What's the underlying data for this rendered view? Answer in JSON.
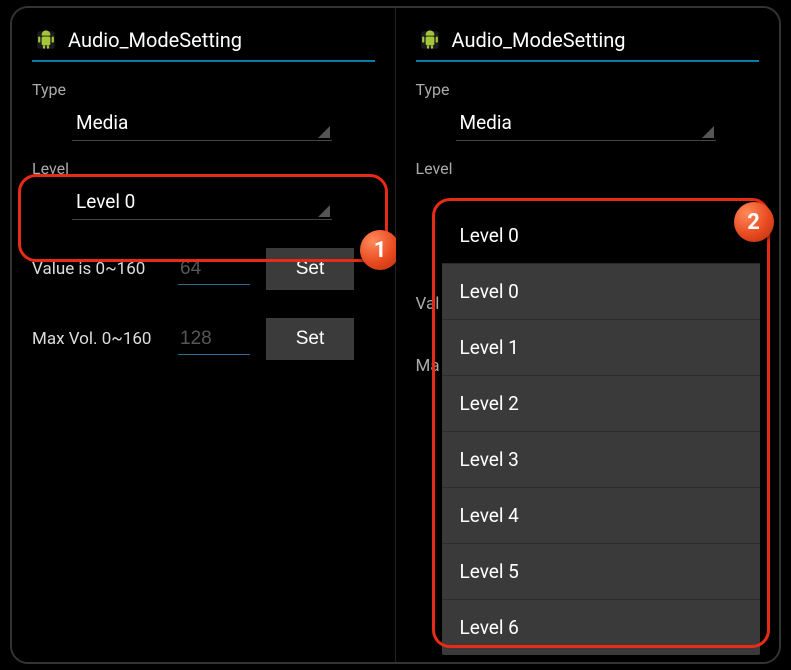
{
  "app": {
    "title": "Audio_ModeSetting"
  },
  "sections": {
    "type_label": "Type",
    "level_label": "Level"
  },
  "type_spinner": {
    "value": "Media"
  },
  "level_spinner": {
    "value": "Level 0"
  },
  "value_row": {
    "label": "Value is 0~160",
    "value": "64",
    "button": "Set"
  },
  "maxvol_row": {
    "label": "Max Vol. 0~160",
    "value": "128",
    "button": "Set"
  },
  "right_hidden": {
    "val": "Val",
    "max": "Ma"
  },
  "dropdown": {
    "selected": "Level 0",
    "options": [
      "Level 0",
      "Level 1",
      "Level 2",
      "Level 3",
      "Level 4",
      "Level 5",
      "Level 6"
    ]
  },
  "callouts": {
    "badge1": "1",
    "badge2": "2"
  }
}
